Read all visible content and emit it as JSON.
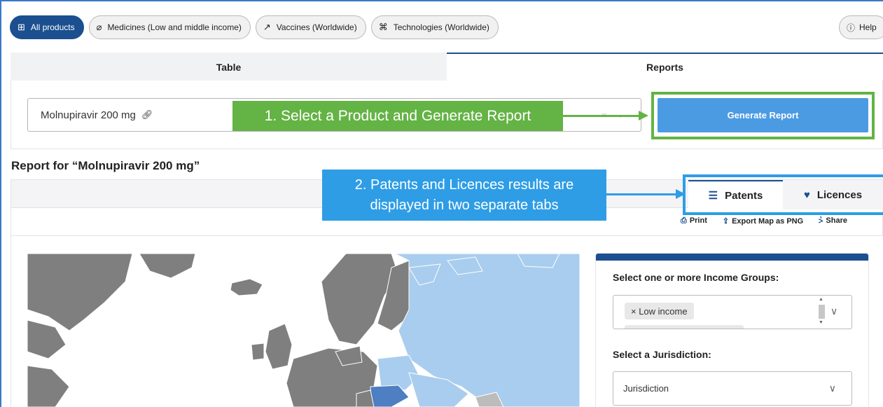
{
  "nav": {
    "pills": [
      {
        "label": "All products",
        "icon": "medical-box-icon"
      },
      {
        "label": "Medicines (Low and middle income)",
        "icon": "pill-icon"
      },
      {
        "label": "Vaccines (Worldwide)",
        "icon": "syringe-icon"
      },
      {
        "label": "Technologies (Worldwide)",
        "icon": "technology-icon"
      }
    ],
    "help_label": "Help"
  },
  "tabs": {
    "table": "Table",
    "reports": "Reports"
  },
  "product": {
    "value": "Molnupiravir 200 mg",
    "clear": "×",
    "chevron": "⌄"
  },
  "callouts": {
    "step1": "1. Select a Product and Generate Report",
    "step2_line1": "2. Patents and Licences results are",
    "step2_line2": "displayed in two separate tabs"
  },
  "generate_label": "Generate Report",
  "report_title": "Report for “Molnupiravir 200 mg”",
  "result_tabs": {
    "patents": "Patents",
    "licences": "Licences"
  },
  "toolbar": {
    "print": "Print",
    "export": "Export Map as PNG",
    "share": "Share"
  },
  "filters": {
    "income_label": "Select one or more Income Groups:",
    "income_chip": "× Low income",
    "jurisdiction_label": "Select a Jurisdiction:",
    "jurisdiction_placeholder": "Jurisdiction"
  },
  "colors": {
    "brand": "#1b4f8f",
    "button": "#4b9be3",
    "callout_green": "#64b345",
    "callout_blue": "#2e9de6",
    "map_no_data": "#7f7f7f",
    "map_light": "#a9cdee",
    "map_dark": "#4d7fc2"
  }
}
